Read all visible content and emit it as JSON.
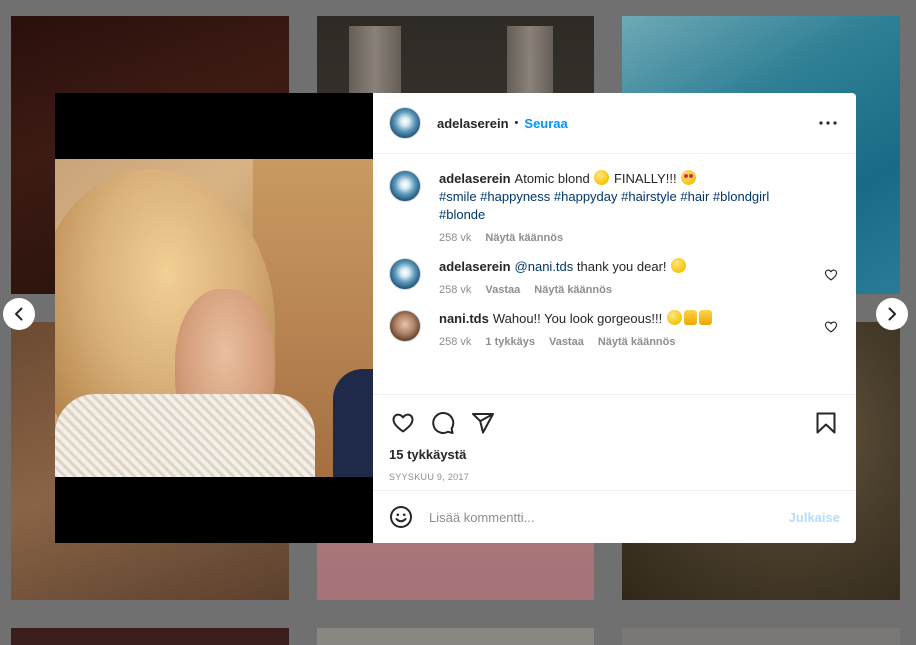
{
  "post": {
    "username": "adelaserein",
    "separator": "•",
    "follow_label": "Seuraa",
    "more_icon": "more-horizontal-icon",
    "image_alt": "selfie-photo",
    "caption": {
      "author": "adelaserein",
      "text": "Atomic blond",
      "text_after": "FINALLY!!!",
      "hashtags": "#smile #happyness #happyday #hairstyle #hair #blondgirl #blonde",
      "time": "258 vk",
      "translate": "Näytä käännös"
    },
    "comments": [
      {
        "author": "adelaserein",
        "mention": "@nani.tds",
        "text": "thank you dear!",
        "time": "258 vk",
        "reply": "Vastaa",
        "translate": "Näytä käännös"
      },
      {
        "author": "nani.tds",
        "text": "Wahou!! You look gorgeous!!!",
        "time": "258 vk",
        "likes": "1 tykkäys",
        "reply": "Vastaa",
        "translate": "Näytä käännös"
      }
    ],
    "likes_count": "15 tykkäystä",
    "date": "SYYSKUU 9, 2017",
    "comment_placeholder": "Lisää kommentti...",
    "publish_label": "Julkaise"
  },
  "colors": {
    "accent": "#0095f6",
    "publish_disabled": "#b2dffc",
    "muted": "#8e8e8e",
    "overlay": "#707070"
  }
}
